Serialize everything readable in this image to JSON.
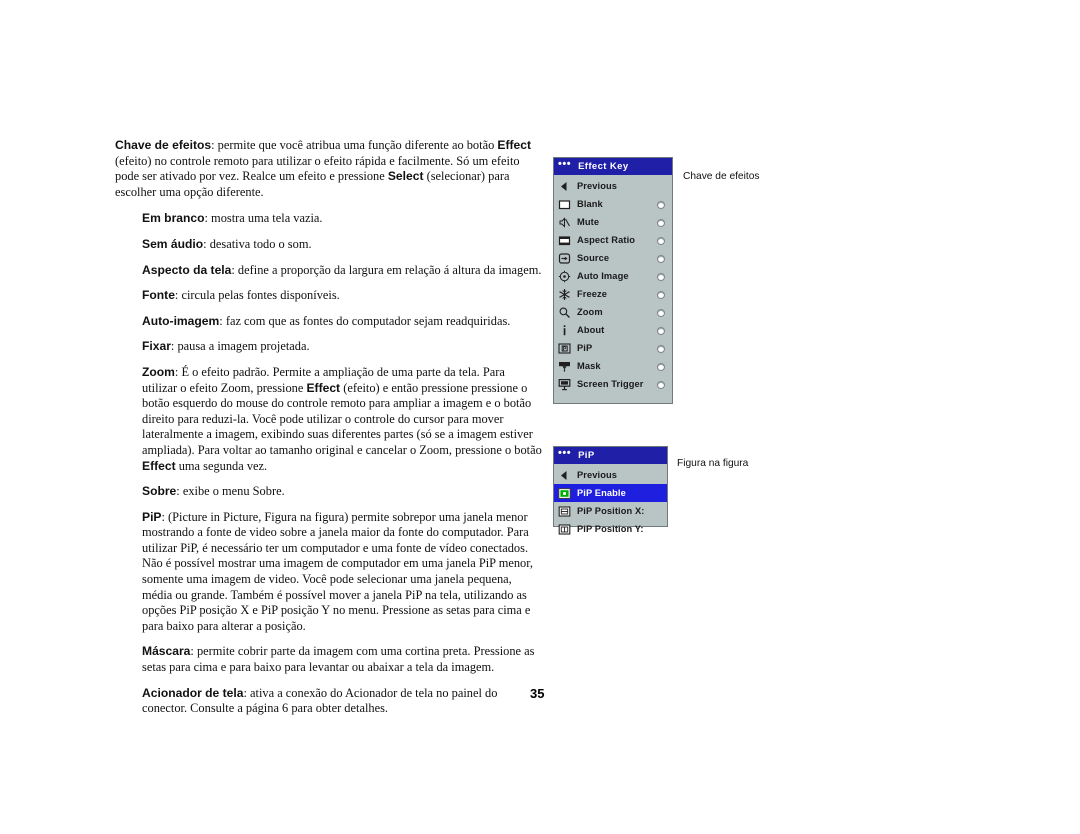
{
  "document": {
    "page_number": "35",
    "paragraphs": [
      {
        "indent": false,
        "runs": [
          {
            "t": "Chave de efeitos",
            "b": true
          },
          {
            "t": ": permite que você atribua uma função diferente ao botão ",
            "b": false
          },
          {
            "t": "Effect",
            "b": true
          },
          {
            "t": " (efeito) no controle remoto para utilizar o efeito rápida e facilmente. Só um efeito pode ser ativado por vez. Realce um efeito e pressione ",
            "b": false
          },
          {
            "t": "Select",
            "b": true
          },
          {
            "t": " (selecionar) para escolher uma opção diferente.",
            "b": false
          }
        ]
      },
      {
        "indent": true,
        "runs": [
          {
            "t": "Em branco",
            "b": true
          },
          {
            "t": ": mostra uma tela vazia.",
            "b": false
          }
        ]
      },
      {
        "indent": true,
        "runs": [
          {
            "t": "Sem áudio",
            "b": true
          },
          {
            "t": ": desativa todo o som.",
            "b": false
          }
        ]
      },
      {
        "indent": true,
        "runs": [
          {
            "t": "Aspecto da tela",
            "b": true
          },
          {
            "t": ": define a proporção da largura em relação á altura da imagem.",
            "b": false
          }
        ]
      },
      {
        "indent": true,
        "runs": [
          {
            "t": "Fonte",
            "b": true
          },
          {
            "t": ": circula pelas fontes disponíveis.",
            "b": false
          }
        ]
      },
      {
        "indent": true,
        "runs": [
          {
            "t": "Auto-imagem",
            "b": true
          },
          {
            "t": ": faz com que as fontes do computador sejam readquiridas.",
            "b": false
          }
        ]
      },
      {
        "indent": true,
        "runs": [
          {
            "t": "Fixar",
            "b": true
          },
          {
            "t": ": pausa a imagem projetada.",
            "b": false
          }
        ]
      },
      {
        "indent": true,
        "runs": [
          {
            "t": "Zoom",
            "b": true
          },
          {
            "t": ": É o efeito padrão. Permite a ampliação de uma parte da tela. Para utilizar o efeito Zoom, pressione ",
            "b": false
          },
          {
            "t": "Effect",
            "b": true
          },
          {
            "t": " (efeito) e então pressione pressione o botão esquerdo do mouse do controle remoto para ampliar a imagem e o botão direito para reduzi-la. Você pode utilizar o controle do cursor para mover lateralmente a imagem, exibindo suas diferentes partes (só se a imagem estiver ampliada). Para voltar ao tamanho original e cancelar o Zoom, pressione o botão ",
            "b": false
          },
          {
            "t": "Effect",
            "b": true
          },
          {
            "t": " uma segunda vez.",
            "b": false
          }
        ]
      },
      {
        "indent": true,
        "runs": [
          {
            "t": "Sobre",
            "b": true
          },
          {
            "t": ": exibe o menu Sobre.",
            "b": false
          }
        ]
      },
      {
        "indent": true,
        "runs": [
          {
            "t": "PiP",
            "b": true
          },
          {
            "t": ": (Picture in Picture, Figura na figura) permite sobrepor uma janela menor mostrando a fonte de video sobre a janela maior da fonte do computador. Para utilizar PiP, é necessário ter um computador e uma fonte de vídeo conectados. Não é possível mostrar uma imagem de computador em uma janela PiP menor, somente uma imagem de video. Você pode selecionar uma janela pequena, média ou grande. Também é possível mover a janela PiP na tela, utilizando as opções PiP posição X e PiP posição Y no menu. Pressione as setas para cima e para baixo para alterar a posição.",
            "b": false
          }
        ]
      },
      {
        "indent": true,
        "runs": [
          {
            "t": "Máscara",
            "b": true
          },
          {
            "t": ": permite cobrir parte da imagem com uma cortina preta. Pressione as setas para cima e para baixo para levantar ou abaixar a tela da imagem.",
            "b": false
          }
        ]
      },
      {
        "indent": true,
        "runs": [
          {
            "t": "Acionador de tela",
            "b": true
          },
          {
            "t": ": ativa a conexão do Acionador de tela no painel do conector. Consulte a página 6 para obter detalhes.",
            "b": false
          }
        ]
      }
    ]
  },
  "colors": {
    "menu_background": "#b9c4c4",
    "menu_titlebar": "#1f1fa8",
    "menu_selected_row": "#1f1fe0",
    "menu_border": "#6f7a7a",
    "pip_enable_icon_green": "#00b000",
    "text": "#111111"
  },
  "effect_key_menu": {
    "title": "Effect Key",
    "title_dots": "•••",
    "rows": [
      {
        "label": "Previous",
        "icon": "left-triangle-icon",
        "radio": false,
        "selected": false
      },
      {
        "label": "Blank",
        "icon": "blank-screen-icon",
        "radio": true,
        "selected": false
      },
      {
        "label": "Mute",
        "icon": "mute-speaker-icon",
        "radio": true,
        "selected": false
      },
      {
        "label": "Aspect Ratio",
        "icon": "aspect-ratio-icon",
        "radio": true,
        "selected": false
      },
      {
        "label": "Source",
        "icon": "source-arrow-icon",
        "radio": true,
        "selected": false
      },
      {
        "label": "Auto Image",
        "icon": "auto-image-icon",
        "radio": true,
        "selected": false
      },
      {
        "label": "Freeze",
        "icon": "freeze-snowflake-icon",
        "radio": true,
        "selected": false
      },
      {
        "label": "Zoom",
        "icon": "magnifier-icon",
        "radio": true,
        "selected": false
      },
      {
        "label": "About",
        "icon": "info-i-icon",
        "radio": true,
        "selected": false
      },
      {
        "label": "PiP",
        "icon": "pip-icon",
        "radio": true,
        "selected": false
      },
      {
        "label": "Mask",
        "icon": "mask-curtain-icon",
        "radio": true,
        "selected": false
      },
      {
        "label": "Screen Trigger",
        "icon": "screen-trigger-icon",
        "radio": true,
        "selected": false
      }
    ]
  },
  "pip_menu": {
    "title": "PiP",
    "title_dots": "•••",
    "rows": [
      {
        "label": "Previous",
        "icon": "left-triangle-icon",
        "selected": false
      },
      {
        "label": "PiP Enable",
        "icon": "pip-enable-icon",
        "selected": true
      },
      {
        "label": "PiP Position X:",
        "icon": "pip-position-x-icon",
        "selected": false
      },
      {
        "label": "PiP Position Y:",
        "icon": "pip-position-y-icon",
        "selected": false
      }
    ]
  },
  "callouts": {
    "effect_key": "Chave de efeitos",
    "pip": "Figura na figura"
  }
}
